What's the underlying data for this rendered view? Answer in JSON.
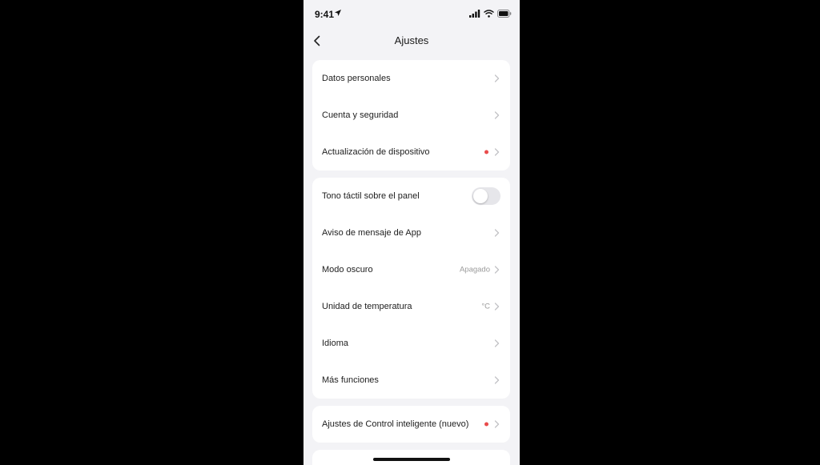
{
  "status_bar": {
    "time": "9:41"
  },
  "nav": {
    "title": "Ajustes"
  },
  "groups": [
    {
      "items": [
        {
          "label": "Datos personales"
        },
        {
          "label": "Cuenta y seguridad"
        },
        {
          "label": "Actualización de dispositivo",
          "badge": "red-dot"
        }
      ]
    },
    {
      "items": [
        {
          "label": "Tono táctil sobre el panel",
          "toggle": false
        },
        {
          "label": "Aviso de mensaje de App"
        },
        {
          "label": "Modo oscuro",
          "value": "Apagado"
        },
        {
          "label": "Unidad de temperatura",
          "value": "°C"
        },
        {
          "label": "Idioma"
        },
        {
          "label": "Más funciones"
        }
      ]
    },
    {
      "items": [
        {
          "label": "Ajustes de Control inteligente (nuevo)",
          "badge": "red-dot"
        }
      ]
    }
  ],
  "colors": {
    "background": "#f3f3f6",
    "card": "#ffffff",
    "badge": "#e94b4b",
    "toggle_off": "#e6e6ea"
  }
}
